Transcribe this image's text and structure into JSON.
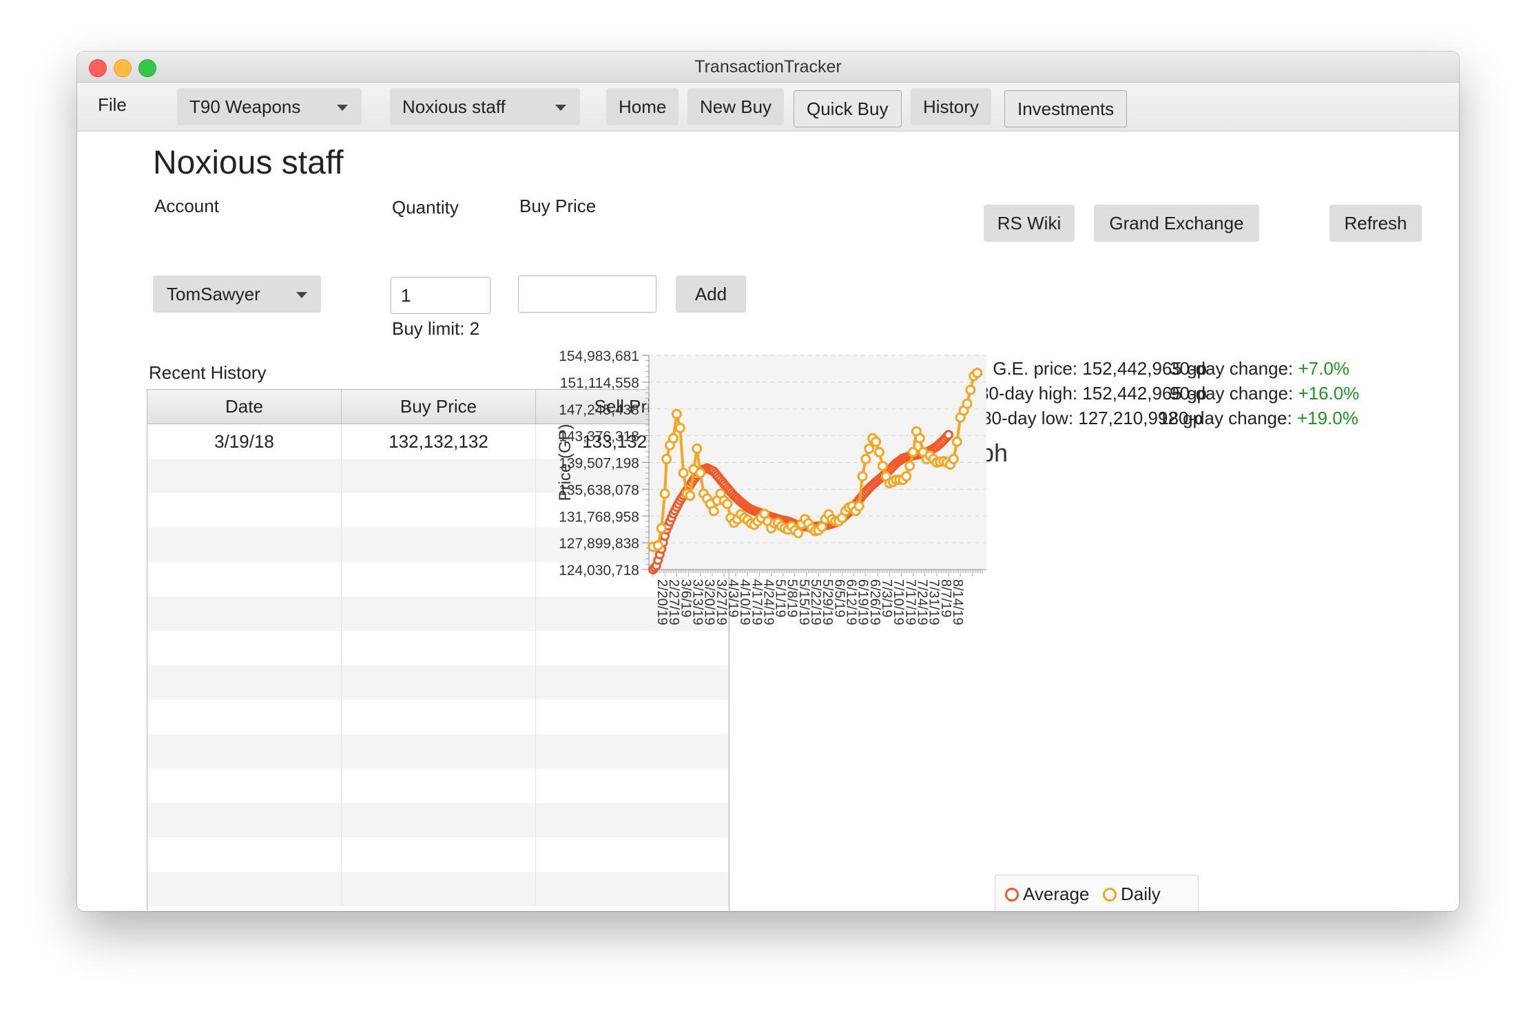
{
  "window": {
    "title": "TransactionTracker"
  },
  "toolbar": {
    "file_menu": "File",
    "category_select": "T90 Weapons",
    "item_select": "Noxious staff",
    "home": "Home",
    "new_buy": "New Buy",
    "quick_buy": "Quick Buy",
    "history": "History",
    "investments": "Investments"
  },
  "item": {
    "name": "Noxious staff"
  },
  "links": {
    "rs_wiki": "RS Wiki",
    "grand_exchange": "Grand Exchange",
    "refresh": "Refresh"
  },
  "form": {
    "account_label": "Account",
    "account_value": "TomSawyer",
    "quantity_label": "Quantity",
    "quantity_value": "1",
    "buy_price_label": "Buy Price",
    "buy_price_value": "",
    "add_button": "Add",
    "buy_limit": "Buy limit: 2"
  },
  "history": {
    "label": "Recent History",
    "columns": [
      "Date",
      "Buy Price",
      "Sell Price"
    ],
    "rows": [
      {
        "date": "3/19/18",
        "buy": "132,132,132",
        "sell": "133,132,132"
      }
    ]
  },
  "stats": {
    "ge_price": "G.E. price: 152,442,965 gp",
    "high_180": "180-day high: 152,442,965 gp",
    "low_180": "180-day low: 127,210,992 gp",
    "change_30_label": "30-day change: ",
    "change_30_value": "+7.0%",
    "change_90_label": "90-day change: ",
    "change_90_value": "+16.0%",
    "change_180_label": "180-day change: ",
    "change_180_value": "+19.0%",
    "positive_color": "#1a9a1a"
  },
  "chart_data": {
    "type": "line",
    "title": "G.E. Market Graph",
    "xlabel": "",
    "ylabel": "Price (GP)",
    "ylim": [
      124030718,
      154983681
    ],
    "y_ticks": [
      "154,983,681",
      "151,114,558",
      "147,245,438",
      "143,376,318",
      "139,507,198",
      "135,638,078",
      "131,768,958",
      "127,899,838",
      "124,030,718"
    ],
    "x_ticks": [
      "2/20/19",
      "2/27/19",
      "3/6/19",
      "3/13/19",
      "3/20/19",
      "3/27/19",
      "4/3/19",
      "4/10/19",
      "4/17/19",
      "4/24/19",
      "5/1/19",
      "5/8/19",
      "5/15/19",
      "5/22/19",
      "5/29/19",
      "6/5/19",
      "6/12/19",
      "6/19/19",
      "6/26/19",
      "7/3/19",
      "7/10/19",
      "7/17/19",
      "7/24/19",
      "7/31/19",
      "8/7/19",
      "8/14/19"
    ],
    "grid": true,
    "legend": "bottom",
    "series": [
      {
        "name": "Average",
        "color": "#f0592a",
        "anchors": [
          [
            0,
            124030718
          ],
          [
            2,
            124600000
          ],
          [
            5,
            127000000
          ],
          [
            8,
            129800000
          ],
          [
            12,
            132100000
          ],
          [
            16,
            134000000
          ],
          [
            20,
            135500000
          ],
          [
            24,
            137000000
          ],
          [
            28,
            138300000
          ],
          [
            32,
            138700000
          ],
          [
            36,
            138200000
          ],
          [
            40,
            137000000
          ],
          [
            44,
            135800000
          ],
          [
            48,
            134700000
          ],
          [
            52,
            133800000
          ],
          [
            56,
            133000000
          ],
          [
            60,
            132500000
          ],
          [
            64,
            132200000
          ],
          [
            68,
            131800000
          ],
          [
            72,
            131500000
          ],
          [
            76,
            131200000
          ],
          [
            80,
            131000000
          ],
          [
            84,
            130600000
          ],
          [
            88,
            130300000
          ],
          [
            92,
            130200000
          ],
          [
            96,
            130250000
          ],
          [
            100,
            130300000
          ],
          [
            104,
            130500000
          ],
          [
            108,
            130800000
          ],
          [
            112,
            131400000
          ],
          [
            116,
            132300000
          ],
          [
            120,
            133500000
          ],
          [
            124,
            134700000
          ],
          [
            128,
            135800000
          ],
          [
            132,
            136700000
          ],
          [
            136,
            137500000
          ],
          [
            140,
            138400000
          ],
          [
            144,
            139400000
          ],
          [
            148,
            140100000
          ],
          [
            152,
            140400000
          ],
          [
            156,
            140600000
          ],
          [
            160,
            140800000
          ],
          [
            164,
            141200000
          ],
          [
            168,
            141800000
          ],
          [
            172,
            142700000
          ],
          [
            175,
            143500000
          ]
        ]
      },
      {
        "name": "Daily",
        "color": "#f7a521",
        "points": [
          [
            0,
            127300000
          ],
          [
            3,
            127500000
          ],
          [
            5,
            130000000
          ],
          [
            7,
            135000000
          ],
          [
            8,
            140000000
          ],
          [
            10,
            142000000
          ],
          [
            12,
            143000000
          ],
          [
            14,
            146500000
          ],
          [
            16,
            144500000
          ],
          [
            18,
            138000000
          ],
          [
            20,
            135000000
          ],
          [
            22,
            134700000
          ],
          [
            24,
            138500000
          ],
          [
            26,
            141500000
          ],
          [
            28,
            138000000
          ],
          [
            30,
            135000000
          ],
          [
            32,
            134300000
          ],
          [
            34,
            133500000
          ],
          [
            36,
            132500000
          ],
          [
            38,
            134000000
          ],
          [
            40,
            135000000
          ],
          [
            42,
            134000000
          ],
          [
            44,
            133500000
          ],
          [
            46,
            131500000
          ],
          [
            48,
            130800000
          ],
          [
            50,
            131300000
          ],
          [
            52,
            132000000
          ],
          [
            54,
            131500000
          ],
          [
            56,
            131200000
          ],
          [
            58,
            130700000
          ],
          [
            60,
            130500000
          ],
          [
            62,
            131000000
          ],
          [
            64,
            131500000
          ],
          [
            66,
            132100000
          ],
          [
            68,
            131000000
          ],
          [
            70,
            130000000
          ],
          [
            72,
            130700000
          ],
          [
            74,
            130800000
          ],
          [
            76,
            130300000
          ],
          [
            78,
            130000000
          ],
          [
            80,
            129800000
          ],
          [
            82,
            130300000
          ],
          [
            84,
            129700000
          ],
          [
            86,
            129300000
          ],
          [
            88,
            130600000
          ],
          [
            90,
            131300000
          ],
          [
            92,
            130700000
          ],
          [
            94,
            130000000
          ],
          [
            96,
            129600000
          ],
          [
            98,
            129700000
          ],
          [
            100,
            130200000
          ],
          [
            102,
            131300000
          ],
          [
            104,
            132000000
          ],
          [
            106,
            131300000
          ],
          [
            108,
            131000000
          ],
          [
            110,
            131000000
          ],
          [
            112,
            131500000
          ],
          [
            114,
            132500000
          ],
          [
            116,
            133000000
          ],
          [
            118,
            133200000
          ],
          [
            120,
            132500000
          ],
          [
            122,
            133200000
          ],
          [
            124,
            137500000
          ],
          [
            126,
            140000000
          ],
          [
            128,
            141500000
          ],
          [
            130,
            143000000
          ],
          [
            132,
            142500000
          ],
          [
            134,
            141000000
          ],
          [
            136,
            139000000
          ],
          [
            138,
            137500000
          ],
          [
            140,
            136500000
          ],
          [
            142,
            136700000
          ],
          [
            144,
            137000000
          ],
          [
            146,
            137000000
          ],
          [
            148,
            137000000
          ],
          [
            150,
            137500000
          ],
          [
            152,
            139000000
          ],
          [
            154,
            141000000
          ],
          [
            156,
            144000000
          ],
          [
            158,
            143000000
          ],
          [
            160,
            141000000
          ],
          [
            162,
            140000000
          ],
          [
            164,
            140500000
          ],
          [
            166,
            140000000
          ],
          [
            168,
            139500000
          ],
          [
            170,
            139600000
          ],
          [
            172,
            139700000
          ],
          [
            174,
            139500000
          ],
          [
            176,
            139200000
          ],
          [
            178,
            140000000
          ],
          [
            180,
            142500000
          ],
          [
            182,
            146000000
          ],
          [
            184,
            147000000
          ],
          [
            186,
            148000000
          ],
          [
            188,
            150000000
          ],
          [
            190,
            152000000
          ],
          [
            192,
            152442965
          ]
        ]
      }
    ]
  }
}
